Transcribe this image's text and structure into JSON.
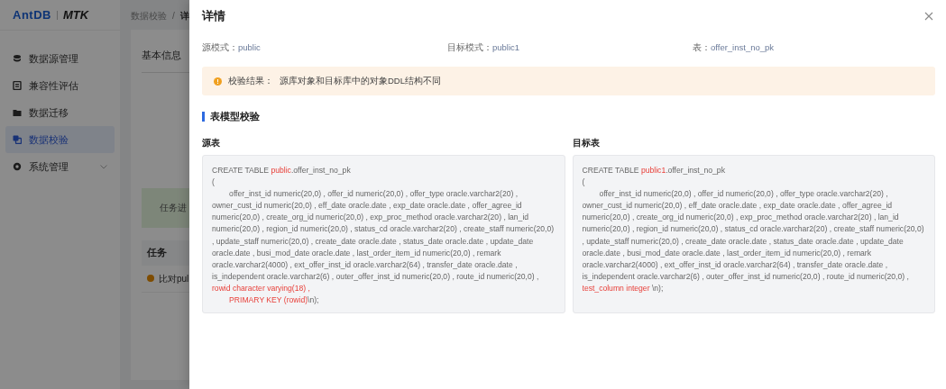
{
  "app": {
    "logo": "AntDB",
    "product": "MTK"
  },
  "sidebar": {
    "items": [
      {
        "label": "数据源管理",
        "selected": false,
        "expandable": false
      },
      {
        "label": "兼容性评估",
        "selected": false,
        "expandable": false
      },
      {
        "label": "数据迁移",
        "selected": false,
        "expandable": false
      },
      {
        "label": "数据校验",
        "selected": true,
        "expandable": false
      },
      {
        "label": "系统管理",
        "selected": false,
        "expandable": true
      }
    ]
  },
  "breadcrumb": {
    "items": [
      "数据校验",
      "详"
    ],
    "separator": "/"
  },
  "background_card": {
    "tab": "基本信息",
    "progress_text": "任务进",
    "table_header": "任务",
    "row_text": "比对pul"
  },
  "drawer": {
    "title": "详情",
    "info": [
      {
        "label": "源模式：",
        "value": "public"
      },
      {
        "label": "目标模式：",
        "value": "public1"
      },
      {
        "label": "表：",
        "value": "offer_inst_no_pk"
      }
    ],
    "alert": {
      "label": "校验结果：",
      "message": "源库对象和目标库中的对象DDL结构不同"
    },
    "section_title": "表模型校验",
    "panels": [
      {
        "title": "源表",
        "ddl": [
          {
            "text": "CREATE TABLE ",
            "highlight": false
          },
          {
            "text": "public",
            "highlight": true
          },
          {
            "text": ".offer_inst_no_pk\n(\n        offer_inst_id numeric(20,0) , offer_id numeric(20,0) , offer_type oracle.varchar2(20) , owner_cust_id numeric(20,0) , eff_date oracle.date , exp_date oracle.date , offer_agree_id numeric(20,0) , create_org_id numeric(20,0) , exp_proc_method oracle.varchar2(20) , lan_id numeric(20,0) , region_id numeric(20,0) , status_cd oracle.varchar2(20) , create_staff numeric(20,0) , update_staff numeric(20,0) , create_date oracle.date , status_date oracle.date , update_date oracle.date , busi_mod_date oracle.date , last_order_item_id numeric(20,0) , remark oracle.varchar2(4000) , ext_offer_inst_id oracle.varchar2(64) , transfer_date oracle.date , is_independent oracle.varchar2(6) , outer_offer_inst_id numeric(20,0) , route_id numeric(20,0) ,\n",
            "highlight": false
          },
          {
            "text": "rowid character varying(18) ,\n        PRIMARY KEY (rowid)",
            "highlight": true
          },
          {
            "text": "\\n);",
            "highlight": false
          }
        ]
      },
      {
        "title": "目标表",
        "ddl": [
          {
            "text": "CREATE TABLE ",
            "highlight": false
          },
          {
            "text": "public1",
            "highlight": true
          },
          {
            "text": ".offer_inst_no_pk\n(\n        offer_inst_id numeric(20,0) , offer_id numeric(20,0) , offer_type oracle.varchar2(20) , owner_cust_id numeric(20,0) , eff_date oracle.date , exp_date oracle.date , offer_agree_id numeric(20,0) , create_org_id numeric(20,0) , exp_proc_method oracle.varchar2(20) , lan_id numeric(20,0) , region_id numeric(20,0) , status_cd oracle.varchar2(20) , create_staff numeric(20,0) , update_staff numeric(20,0) , create_date oracle.date , status_date oracle.date , update_date oracle.date , busi_mod_date oracle.date , last_order_item_id numeric(20,0) , remark oracle.varchar2(4000) , ext_offer_inst_id oracle.varchar2(64) , transfer_date oracle.date , is_independent oracle.varchar2(6) , outer_offer_inst_id numeric(20,0) , route_id numeric(20,0) ,\n",
            "highlight": false
          },
          {
            "text": "test_column integer",
            "highlight": true
          },
          {
            "text": " \\n);",
            "highlight": false
          }
        ]
      }
    ]
  }
}
